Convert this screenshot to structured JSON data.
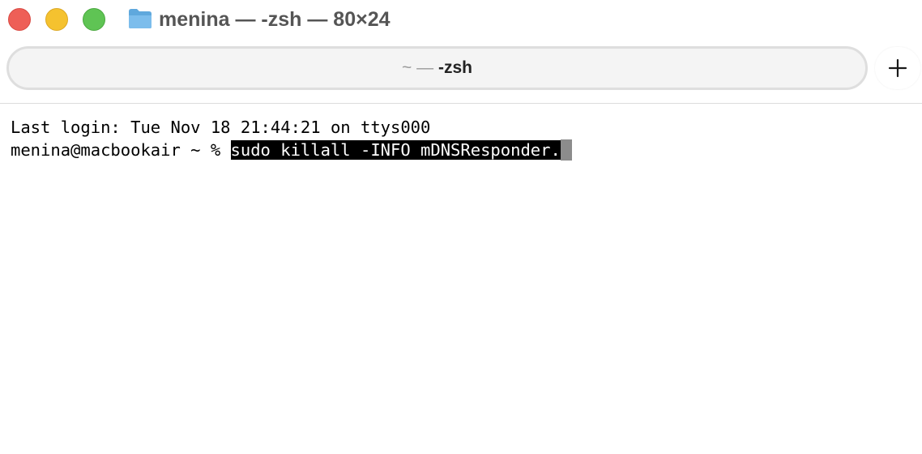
{
  "window": {
    "title": "menina — -zsh — 80×24",
    "folder_icon": "folder-icon"
  },
  "traffic_lights": {
    "close_color": "#ee5f57",
    "minimize_color": "#f5c22f",
    "zoom_color": "#5fc454"
  },
  "tabbar": {
    "tab": {
      "path_prefix": "~ — ",
      "process": "-zsh"
    },
    "new_tab_label": "+"
  },
  "terminal": {
    "line1": "Last login: Tue Nov 18 21:44:21 on ttys000",
    "prompt": "menina@macbookair ~ % ",
    "command": "sudo killall -INFO mDNSResponder."
  }
}
